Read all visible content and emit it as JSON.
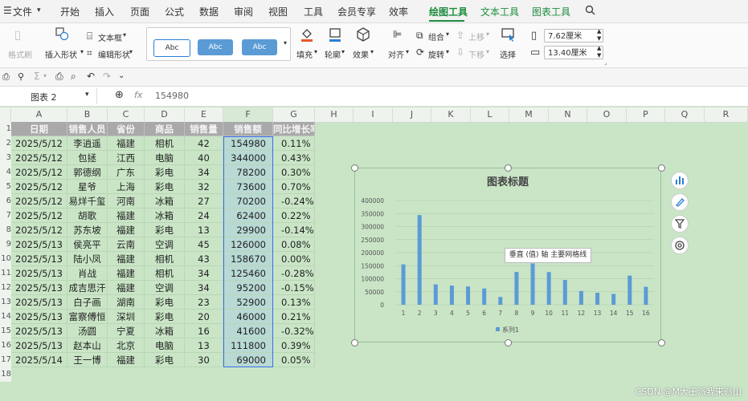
{
  "menu": {
    "file": "文件",
    "tabs": [
      "开始",
      "插入",
      "页面",
      "公式",
      "数据",
      "审阅",
      "视图",
      "工具",
      "会员专享",
      "效率"
    ],
    "context_tabs": [
      "绘图工具",
      "文本工具",
      "图表工具"
    ]
  },
  "ribbon": {
    "format_painter": "格式刷",
    "insert_shape": "插入形状",
    "text_box": "文本框",
    "edit_shape": "编辑形状",
    "style_sample": "Abc",
    "fill": "填充",
    "outline": "轮廓",
    "effect": "效果",
    "align": "对齐",
    "group": "组合",
    "rotate": "旋转",
    "bring_up": "上移",
    "send_down": "下移",
    "select": "选择",
    "height": "7.62厘米",
    "width": "13.40厘米"
  },
  "formula_bar": {
    "name_box": "图表 2",
    "fx": "fx",
    "value": "154980"
  },
  "columns": [
    "A",
    "B",
    "C",
    "D",
    "E",
    "F",
    "G",
    "H",
    "I",
    "J",
    "K",
    "L",
    "M",
    "N",
    "O",
    "P",
    "Q",
    "R"
  ],
  "rows": [
    "1",
    "2",
    "3",
    "4",
    "5",
    "6",
    "7",
    "8",
    "9",
    "10",
    "11",
    "12",
    "13",
    "14",
    "15",
    "16",
    "17",
    "18"
  ],
  "table": {
    "headers": [
      "日期",
      "销售人员",
      "省份",
      "商品",
      "销售量",
      "销售额",
      "同比增长率"
    ],
    "data": [
      [
        "2025/5/12",
        "李逍遥",
        "福建",
        "相机",
        "42",
        "154980",
        "0.11%"
      ],
      [
        "2025/5/12",
        "包拯",
        "江西",
        "电脑",
        "40",
        "344000",
        "0.43%"
      ],
      [
        "2025/5/12",
        "郭德纲",
        "广东",
        "彩电",
        "34",
        "78200",
        "0.30%"
      ],
      [
        "2025/5/12",
        "星爷",
        "上海",
        "彩电",
        "32",
        "73600",
        "0.70%"
      ],
      [
        "2025/5/12",
        "易烊千玺",
        "河南",
        "冰箱",
        "27",
        "70200",
        "-0.24%"
      ],
      [
        "2025/5/12",
        "胡歌",
        "福建",
        "冰箱",
        "24",
        "62400",
        "0.22%"
      ],
      [
        "2025/5/12",
        "苏东坡",
        "福建",
        "彩电",
        "13",
        "29900",
        "-0.14%"
      ],
      [
        "2025/5/13",
        "侯亮平",
        "云南",
        "空调",
        "45",
        "126000",
        "0.08%"
      ],
      [
        "2025/5/13",
        "陆小凤",
        "福建",
        "相机",
        "43",
        "158670",
        "0.00%"
      ],
      [
        "2025/5/13",
        "肖战",
        "福建",
        "相机",
        "34",
        "125460",
        "-0.28%"
      ],
      [
        "2025/5/13",
        "成吉思汗",
        "福建",
        "空调",
        "34",
        "95200",
        "-0.15%"
      ],
      [
        "2025/5/13",
        "白子画",
        "湖南",
        "彩电",
        "23",
        "52900",
        "0.13%"
      ],
      [
        "2025/5/13",
        "富察傅恒",
        "深圳",
        "彩电",
        "20",
        "46000",
        "0.21%"
      ],
      [
        "2025/5/13",
        "汤圆",
        "宁夏",
        "冰箱",
        "16",
        "41600",
        "-0.32%"
      ],
      [
        "2025/5/13",
        "赵本山",
        "北京",
        "电脑",
        "13",
        "111800",
        "0.39%"
      ],
      [
        "2025/5/14",
        "王一博",
        "福建",
        "彩电",
        "30",
        "69000",
        "0.05%"
      ]
    ]
  },
  "tooltip": "垂直 (值) 轴 主要网格线",
  "watermark": "CSDN @M大王派我来巡山",
  "chart_data": {
    "type": "bar",
    "title": "图表标题",
    "categories": [
      "1",
      "2",
      "3",
      "4",
      "5",
      "6",
      "7",
      "8",
      "9",
      "10",
      "11",
      "12",
      "13",
      "14",
      "15",
      "16"
    ],
    "series": [
      {
        "name": "系列1",
        "values": [
          154980,
          344000,
          78200,
          73600,
          70200,
          62400,
          29900,
          126000,
          158670,
          125460,
          95200,
          52900,
          46000,
          41600,
          111800,
          69000
        ]
      }
    ],
    "ylim": [
      0,
      400000
    ],
    "yticks": [
      "400000",
      "350000",
      "300000",
      "250000",
      "200000",
      "150000",
      "100000",
      "50000",
      "0"
    ],
    "legend": "bottom",
    "grid": true,
    "color": "#5b9bd5"
  }
}
